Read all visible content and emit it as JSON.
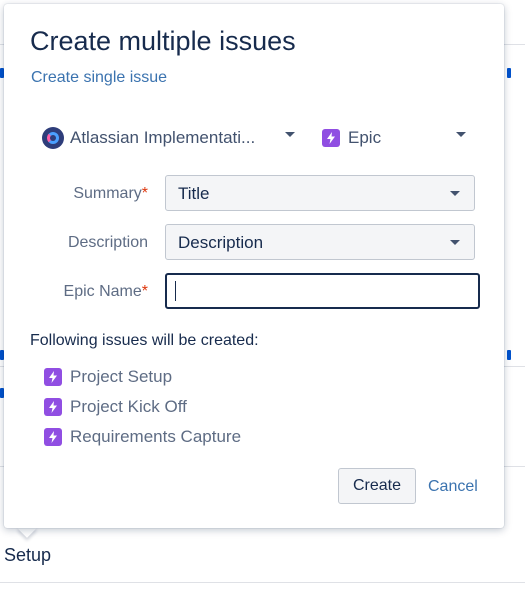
{
  "dialog": {
    "title": "Create multiple issues",
    "create_single_link": "Create single issue",
    "project": {
      "name": "Atlassian Implementati..."
    },
    "issue_type": {
      "name": "Epic",
      "icon": "lightning-icon",
      "color": "#904ee2"
    },
    "fields": {
      "summary": {
        "label": "Summary",
        "required_mark": "*",
        "value": "Title"
      },
      "description": {
        "label": "Description",
        "value": "Description"
      },
      "epic_name": {
        "label": "Epic Name",
        "required_mark": "*",
        "value": ""
      }
    },
    "following_text": "Following issues will be created:",
    "issues": [
      {
        "name": "Project Setup"
      },
      {
        "name": "Project Kick Off"
      },
      {
        "name": "Requirements Capture"
      }
    ],
    "buttons": {
      "create": "Create",
      "cancel": "Cancel"
    }
  },
  "background": {
    "setup_label": "Setup"
  },
  "colors": {
    "link": "#3b73af",
    "required": "#de350b",
    "text": "#172b4d"
  }
}
